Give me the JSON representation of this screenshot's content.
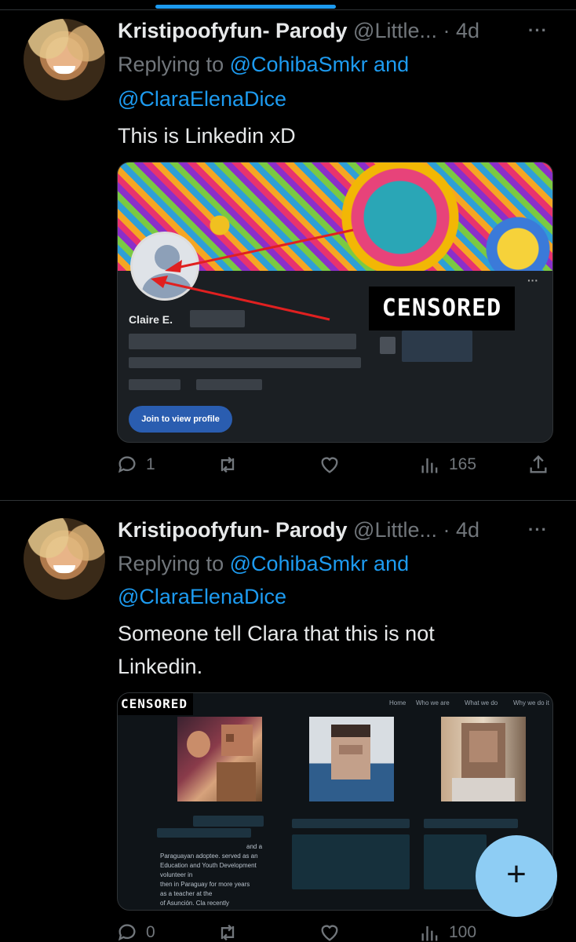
{
  "tweets": [
    {
      "author_name": "Kristipoofyfun- Parody",
      "handle": "@Little...",
      "time": "· 4d",
      "replying_prefix": "Replying to ",
      "reply_mention_1": "@CohibaSmkr and",
      "reply_mention_2": "@ClaraElenaDice",
      "text": "This is Linkedin xD",
      "card": {
        "name": "Claire E.",
        "button": "Join to view profile",
        "censored": "CENSORED",
        "more": "···"
      },
      "actions": {
        "replies": "1",
        "retweets": "",
        "likes": "",
        "views": "165"
      }
    },
    {
      "author_name": "Kristipoofyfun- Parody",
      "handle": "@Little...",
      "time": "· 4d",
      "replying_prefix": "Replying to ",
      "reply_mention_1": "@CohibaSmkr and",
      "reply_mention_2": "@ClaraElenaDice",
      "text_line1": "Someone tell Clara that this is not",
      "text_line2": "Linkedin.",
      "card": {
        "censored": "CENSORED",
        "nav": [
          "Home",
          "Who we are",
          "What we do",
          "Why we do it"
        ],
        "bio": [
          "and a",
          "Paraguayan adoptee.     served as an",
          "Education and Youth Development",
          "volunteer in",
          "then      in Paraguay for   more years",
          "as a teacher at the",
          "of Asunción. Cla     recently"
        ]
      },
      "actions": {
        "replies": "0",
        "retweets": "",
        "likes": "",
        "views": "100"
      }
    }
  ],
  "more_glyph": "···",
  "fab_label": "+",
  "colors": {
    "accent": "#1d9bf0",
    "muted": "#71767b",
    "fab": "#8ecdf4"
  }
}
